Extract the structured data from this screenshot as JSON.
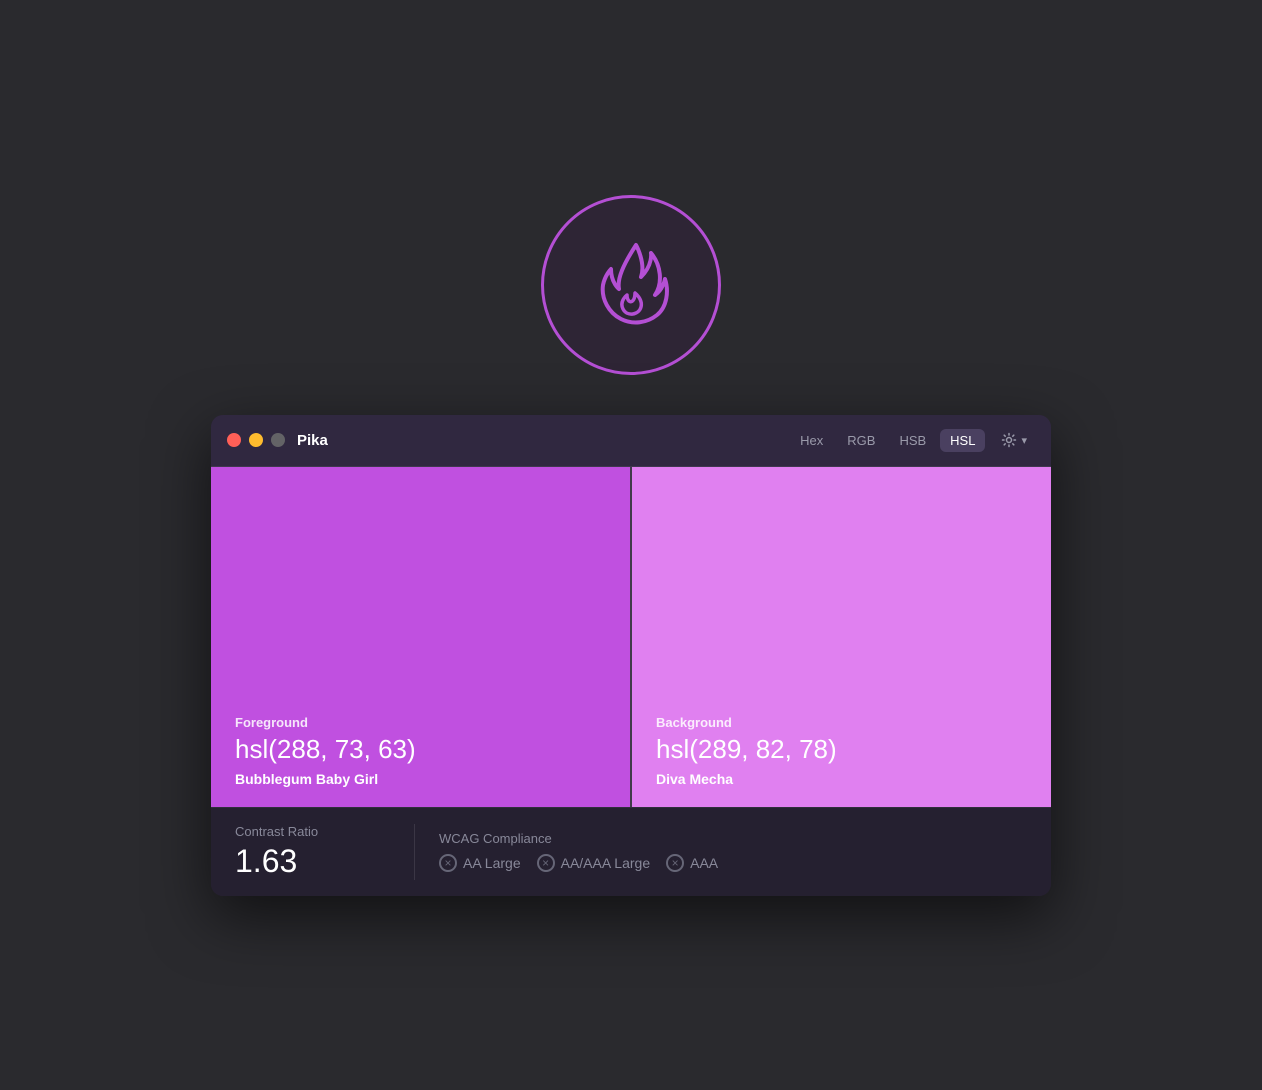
{
  "app": {
    "icon_label": "Pika flame icon"
  },
  "titlebar": {
    "title": "Pika",
    "traffic_lights": {
      "close": "close",
      "minimize": "minimize",
      "maximize": "maximize"
    },
    "format_tabs": [
      {
        "label": "Hex",
        "active": false
      },
      {
        "label": "RGB",
        "active": false
      },
      {
        "label": "HSB",
        "active": false
      },
      {
        "label": "HSL",
        "active": true
      }
    ],
    "settings_label": ""
  },
  "swatches": {
    "foreground": {
      "label": "Foreground",
      "value": "hsl(288, 73, 63)",
      "name": "Bubblegum Baby Girl",
      "color": "#c050e0"
    },
    "background": {
      "label": "Background",
      "value": "hsl(289, 82, 78)",
      "name": "Diva Mecha",
      "color": "#e080f0"
    }
  },
  "bottom": {
    "contrast_label": "Contrast Ratio",
    "contrast_value": "1.63",
    "wcag_label": "WCAG Compliance",
    "badges": [
      {
        "label": "AA Large"
      },
      {
        "label": "AA/AAA Large"
      },
      {
        "label": "AAA"
      }
    ]
  }
}
